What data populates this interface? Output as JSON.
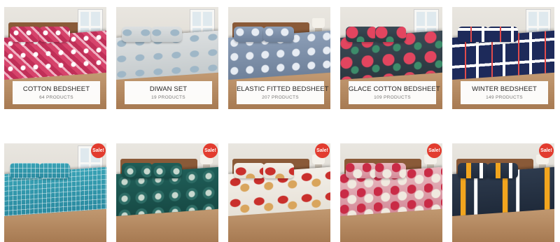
{
  "categories": [
    {
      "title": "COTTON BEDSHEET",
      "count": "64 PRODUCTS",
      "pattern": "pat-cotton"
    },
    {
      "title": "DIWAN SET",
      "count": "19 PRODUCTS",
      "pattern": "pat-diwan"
    },
    {
      "title": "ELASTIC FITTED BEDSHEET",
      "count": "207 PRODUCTS",
      "pattern": "pat-elastic"
    },
    {
      "title": "GLACE COTTON BEDSHEET",
      "count": "109 PRODUCTS",
      "pattern": "pat-glace"
    },
    {
      "title": "WINTER BEDSHEET",
      "count": "149 PRODUCTS",
      "pattern": "pat-winter"
    }
  ],
  "products": [
    {
      "badge": "Sale!",
      "pattern": "pat-teal"
    },
    {
      "badge": "Sale!",
      "pattern": "pat-green"
    },
    {
      "badge": "Sale!",
      "pattern": "pat-leaf"
    },
    {
      "badge": "Sale!",
      "pattern": "pat-hex"
    },
    {
      "badge": "Sale!",
      "pattern": "pat-geo"
    }
  ],
  "colors": {
    "sale_badge": "#e23c2f",
    "label_bg": "#ffffff"
  }
}
